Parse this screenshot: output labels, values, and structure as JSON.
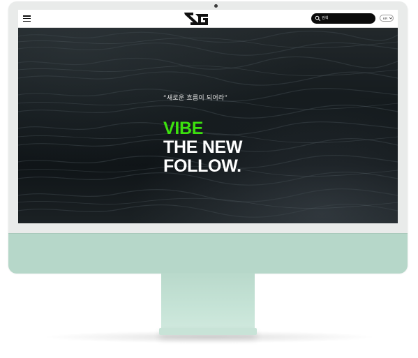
{
  "header": {
    "menu_icon": "hamburger-icon",
    "logo_icon": "yg-logo",
    "search": {
      "placeholder": "검색",
      "icon": "search-icon"
    },
    "language": {
      "selected": "KR",
      "icon": "chevron-down-icon"
    }
  },
  "hero": {
    "tagline": "“새로운 흐름이 되어라”",
    "headline": {
      "line1": "VIBE",
      "line2": "THE NEW",
      "line3": "FOLLOW."
    }
  },
  "colors": {
    "accent": "#3ce10e",
    "monitor_chin": "#b6d7c9",
    "search_bg": "#0b0b0b"
  }
}
